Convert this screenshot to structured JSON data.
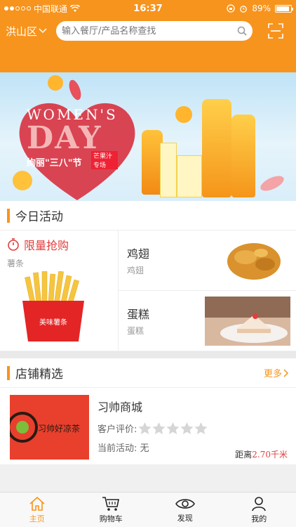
{
  "status_bar": {
    "carrier": "中国联通",
    "time": "16:37",
    "battery": "89%",
    "battery_level": 0.89
  },
  "header": {
    "city": "洪山区",
    "search_placeholder": "输入餐厅/产品名称查找",
    "icons": [
      "chevron-down-icon",
      "search-icon",
      "scan-icon"
    ]
  },
  "banner": {
    "line1": "WOMEN'S",
    "line2": "DAY",
    "line3": "绚丽\"三八\"节",
    "tag": "芒果汁专场"
  },
  "today": {
    "title": "今日活动",
    "flash": {
      "label": "限量抢购",
      "item": "薯条",
      "box_text": "美味薯条"
    },
    "items": [
      {
        "name": "鸡翅",
        "sub": "鸡翅"
      },
      {
        "name": "蛋糕",
        "sub": "蛋糕"
      }
    ]
  },
  "shops": {
    "title": "店铺精选",
    "more": "更多",
    "list": [
      {
        "name": "习帅商城",
        "rating_label": "客户评价:",
        "rating": 0,
        "rating_max": 5,
        "promo": "当前活动: 无",
        "distance_label": "距离",
        "distance_value": "2.70千米",
        "logo_text": "习帅好凉茶"
      }
    ]
  },
  "tabbar": {
    "items": [
      {
        "label": "主页",
        "icon": "home-icon",
        "active": true
      },
      {
        "label": "购物车",
        "icon": "cart-icon",
        "active": false
      },
      {
        "label": "发现",
        "icon": "eye-icon",
        "active": false
      },
      {
        "label": "我的",
        "icon": "user-icon",
        "active": false
      }
    ]
  },
  "colors": {
    "accent": "#f7941d",
    "price_red": "#e23e3e"
  }
}
